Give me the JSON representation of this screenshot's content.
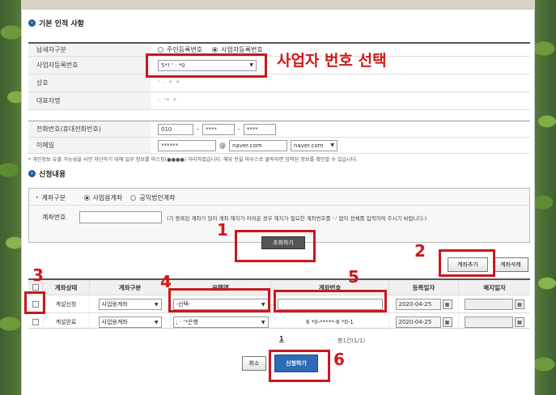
{
  "section1": {
    "title": "기본 인적 사항",
    "taxpayer_type": {
      "label": "납세자구분",
      "opt1": "주민등록번호",
      "opt2": "사업자등록번호"
    },
    "biz_number": {
      "label": "사업자등록번호",
      "value": "5*!  '  ·  *0"
    },
    "trade_name": {
      "label": "상호",
      "value": "' · * *"
    },
    "ceo_name": {
      "label": "대표자명",
      "value": "· '* *"
    },
    "phone": {
      "label": "전화번호(휴대전화번호)",
      "p1": "010",
      "p2": "****",
      "p3": "****",
      "sep": "-"
    },
    "email": {
      "label": "이메일",
      "local": "******",
      "at": "@",
      "domain": "naver.com",
      "domain_select": "naver.com"
    },
    "notice": "* 개인정보 유출 가능성을 사전 차단하기 위해 일부 정보를 마스킹(●●●●) 처리하였습니다. 해당 칸을 마우스로 클릭하면 입력된 정보를 확인할 수 있습니다."
  },
  "section2": {
    "title": "신청내용",
    "account_type": {
      "label": "계좌구분",
      "opt1": "사업용계좌",
      "opt2": "공익법인계좌"
    },
    "account_no": {
      "label": "계좌번호",
      "hint": "(기 등록된 계좌가 많아 계좌 해지가 어려운 경우 해지가 필요한 계좌번호를 '-' 없이 전체를 입력하여 주시기 바랍니다.)"
    },
    "lookup_button": "조회하기",
    "add_button": "계좌추가",
    "delete_button": "계좌삭제"
  },
  "table": {
    "headers": [
      "",
      "계좌상태",
      "계좌구분",
      "은행명",
      "계좌번호",
      "등록일자",
      "해지일자"
    ],
    "rows": [
      {
        "status": "계설신청",
        "type": "사업용계좌",
        "bank": "-선택-",
        "account": "",
        "reg_date": "2020-04-25",
        "end_date": ""
      },
      {
        "status": "계설완료",
        "type": "사업용계좌",
        "bank": "; · '*은행",
        "account": "6 *0-*****-6  *0-1",
        "reg_date": "2020-04-25",
        "end_date": ""
      }
    ]
  },
  "pagination": {
    "current": "1",
    "total_text": "총1건(1/1)"
  },
  "footer": {
    "cancel": "취소",
    "apply": "신청하기"
  },
  "annotations": {
    "headline": "사업자 번호 선택",
    "n1": "1",
    "n2": "2",
    "n3": "3",
    "n4": "4",
    "n5": "5",
    "n6": "6"
  },
  "icons": {
    "section": "info-circle-icon",
    "calendar": "calendar-icon",
    "dropdown": "chevron-down-icon"
  },
  "colors": {
    "annotation": "#c8181e",
    "apply_button": "#2d6bb6",
    "section_dot": "#1f5f9f"
  }
}
